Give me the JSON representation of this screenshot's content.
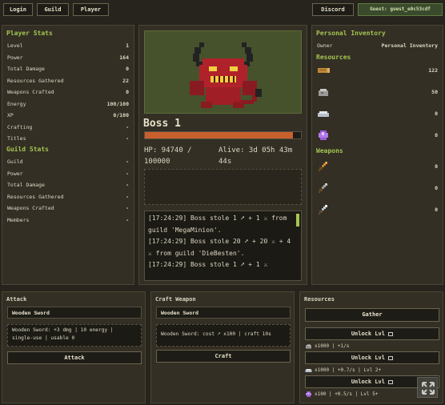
{
  "topbar": {
    "login": "Login",
    "guild": "Guild",
    "player": "Player",
    "discord": "Discord",
    "guest": "Guest: guest_e0c53cdf"
  },
  "player_stats": {
    "title": "Player Stats",
    "rows": [
      {
        "label": "Level",
        "value": "1"
      },
      {
        "label": "Power",
        "value": "164"
      },
      {
        "label": "Total Damage",
        "value": "0"
      },
      {
        "label": "Resources Gathered",
        "value": "22"
      },
      {
        "label": "Weapons Crafted",
        "value": "0"
      },
      {
        "label": "Energy",
        "value": "100/100"
      },
      {
        "label": "XP",
        "value": "0/100"
      },
      {
        "label": "Crafting",
        "value": "-"
      },
      {
        "label": "Titles",
        "value": "-"
      }
    ]
  },
  "guild_stats": {
    "title": "Guild Stats",
    "rows": [
      {
        "label": "Guild",
        "value": "-"
      },
      {
        "label": "Power",
        "value": "-"
      },
      {
        "label": "Total Damage",
        "value": "-"
      },
      {
        "label": "Resources Gathered",
        "value": "-"
      },
      {
        "label": "Weapons Crafted",
        "value": "-"
      },
      {
        "label": "Members",
        "value": "-"
      }
    ]
  },
  "boss": {
    "name": "Boss 1",
    "hp_text": "HP: 94740 / 100000",
    "alive_text": "Alive: 3d 05h 43m 44s",
    "hp_fraction": 0.9474,
    "hp_color": "#c8602e",
    "log": [
      "[17:24:29] Boss stole 1 ➚ + 1 ⚔ from guild 'MegaMinion'.",
      "[17:24:29] Boss stole 20 ➚ + 20 ⚔ + 4 ⚔ from guild 'DieBesten'.",
      "[17:24:29] Boss stole 1 ➚ + 1 ⚔"
    ]
  },
  "inventory": {
    "title": "Personal Inventory",
    "owner_label": "Owner",
    "owner_value": "Personal Inventory",
    "resources_title": "Resources",
    "resources": [
      {
        "icon": "wood-log-icon",
        "value": "122"
      },
      {
        "icon": "stone-ore-icon",
        "value": "50"
      },
      {
        "icon": "iron-ingot-icon",
        "value": "0"
      },
      {
        "icon": "amethyst-crystal-icon",
        "value": "0"
      }
    ],
    "weapons_title": "Weapons",
    "weapons": [
      {
        "icon": "wooden-sword-icon",
        "value": "0"
      },
      {
        "icon": "stone-sword-icon",
        "value": "0"
      },
      {
        "icon": "iron-sword-icon",
        "value": "0"
      }
    ]
  },
  "attack": {
    "title": "Attack",
    "weapon": "Wooden Sword",
    "info": "Wooden Sword: +3 dmg | 10 energy | single-use | usable 0",
    "button": "Attack"
  },
  "craft": {
    "title": "Craft Weapon",
    "weapon": "Wooden Sword",
    "info": "Wooden Sword: cost ➚ x100 | craft 10s",
    "button": "Craft"
  },
  "resources_panel": {
    "title": "Resources",
    "gather": "Gather",
    "unlocks": [
      {
        "label": "Unlock Lvl",
        "info": "x1000 | +1/s"
      },
      {
        "label": "Unlock Lvl",
        "info": "x1000 | +0.7/s | Lvl 2+"
      },
      {
        "label": "Unlock Lvl",
        "info": "x100 | +0.5/s | Lvl 5+"
      }
    ]
  },
  "colors": {
    "accent": "#a6c552",
    "panel": "#332f24",
    "background": "#26241c",
    "hp_bar": "#c8602e"
  }
}
